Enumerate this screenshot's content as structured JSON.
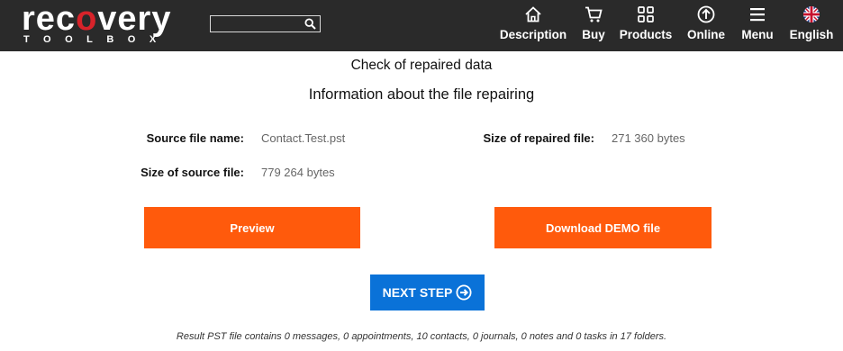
{
  "header": {
    "logo_word_pre": "rec",
    "logo_word_o": "o",
    "logo_word_post": "very",
    "logo_sub": "TOOLBOX",
    "search_value": "",
    "nav": [
      {
        "label": "Description",
        "icon": "home-icon"
      },
      {
        "label": "Buy",
        "icon": "cart-icon"
      },
      {
        "label": "Products",
        "icon": "grid-icon"
      },
      {
        "label": "Online",
        "icon": "upload-circle-icon"
      },
      {
        "label": "Menu",
        "icon": "hamburger-icon"
      },
      {
        "label": "English",
        "icon": "uk-flag-icon"
      }
    ]
  },
  "main": {
    "title": "Check of repaired data",
    "subtitle": "Information about the file repairing",
    "source_name_label": "Source file name:",
    "source_name_value": "Contact.Test.pst",
    "source_size_label": "Size of source file:",
    "source_size_value": "779 264 bytes",
    "repaired_size_label": "Size of repaired file:",
    "repaired_size_value": "271 360 bytes",
    "preview_label": "Preview",
    "download_label": "Download DEMO file",
    "next_label": "NEXT STEP",
    "result_text": "Result PST file contains 0 messages, 0 appointments, 10 contacts, 0 journals, 0 notes and 0 tasks in 17 folders."
  },
  "colors": {
    "header_bg": "#2a2a2a",
    "accent_orange": "#ff5a0c",
    "accent_blue": "#0a72d8",
    "logo_red": "#d8232a"
  }
}
